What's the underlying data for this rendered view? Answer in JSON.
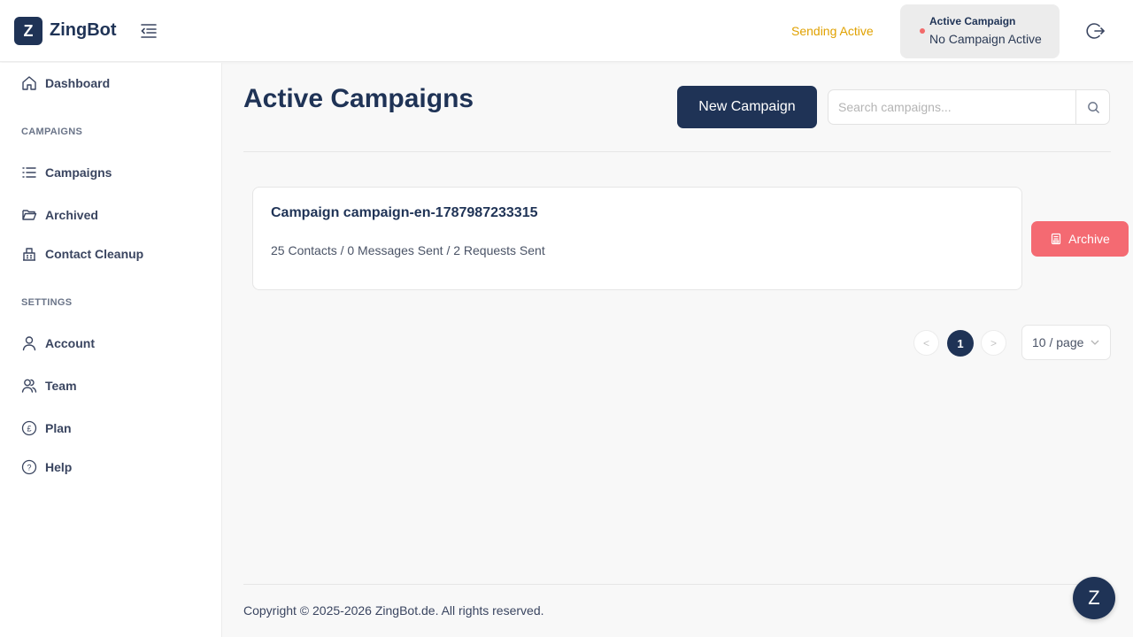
{
  "header": {
    "logo_letter": "Z",
    "brand": "ZingBot",
    "sending_status": "Sending Active",
    "active_campaign_title": "Active Campaign",
    "active_campaign_value": "No Campaign Active"
  },
  "sidebar": {
    "dashboard": "Dashboard",
    "campaigns_section": "CAMPAIGNS",
    "campaigns": "Campaigns",
    "archived": "Archived",
    "contact_cleanup": "Contact Cleanup",
    "settings_section": "SETTINGS",
    "account": "Account",
    "team": "Team",
    "plan": "Plan",
    "help": "Help"
  },
  "main": {
    "title": "Active Campaigns",
    "new_campaign_label": "New Campaign",
    "search_placeholder": "Search campaigns...",
    "campaigns": [
      {
        "title": "Campaign campaign-en-1787987233315",
        "stats": "25 Contacts / 0 Messages Sent / 2 Requests Sent",
        "archive_label": "Archive"
      }
    ],
    "pagination": {
      "prev": "<",
      "current": "1",
      "next": ">",
      "page_size": "10 / page"
    }
  },
  "footer": {
    "copyright": "Copyright © 2025-2026 ZingBot.de. All rights reserved.",
    "fab_letter": "Z"
  },
  "colors": {
    "primary": "#1f3356",
    "sending": "#e0a100",
    "archive": "#f46a72",
    "status_dot": "#f26a6a"
  }
}
